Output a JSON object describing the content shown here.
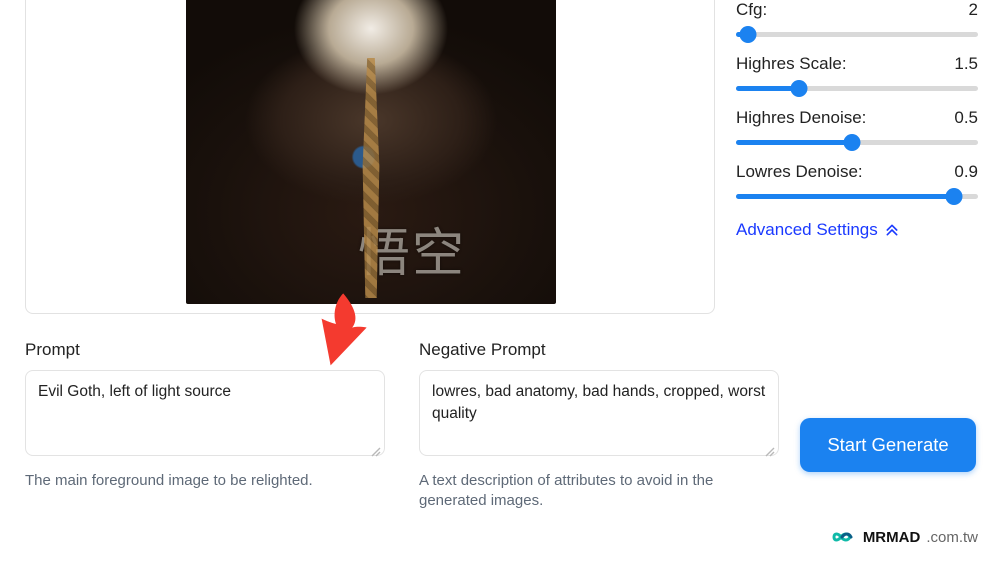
{
  "image": {
    "caption_glyphs": "悟空"
  },
  "sliders": {
    "cfg": {
      "label": "Cfg:",
      "value": "2",
      "fill_pct": 5
    },
    "hscale": {
      "label": "Highres Scale:",
      "value": "1.5",
      "fill_pct": 26
    },
    "hden": {
      "label": "Highres Denoise:",
      "value": "0.5",
      "fill_pct": 48
    },
    "lden": {
      "label": "Lowres Denoise:",
      "value": "0.9",
      "fill_pct": 90
    }
  },
  "advanced_label": "Advanced Settings",
  "prompt": {
    "label": "Prompt",
    "value": "Evil Goth, left of light source",
    "help": "The main foreground image to be relighted."
  },
  "negative": {
    "label": "Negative Prompt",
    "value": "lowres, bad anatomy, bad hands, cropped, worst quality",
    "help": "A text description of attributes to avoid in the generated images."
  },
  "generate_label": "Start Generate",
  "watermark": {
    "brand": "MRMAD",
    "suffix": ".com.tw"
  }
}
